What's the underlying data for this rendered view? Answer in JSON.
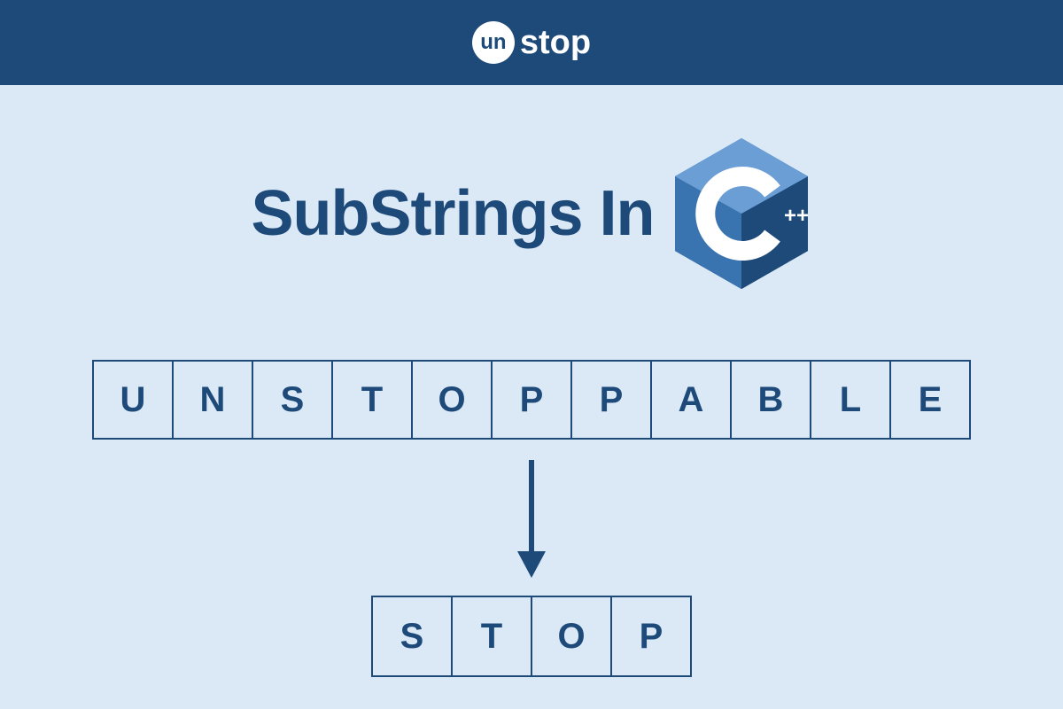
{
  "header": {
    "logo_un": "un",
    "logo_stop": "stop"
  },
  "title": "SubStrings In",
  "cpp_logo": {
    "letter": "C",
    "plusplus": "++"
  },
  "main_word": [
    "U",
    "N",
    "S",
    "T",
    "O",
    "P",
    "P",
    "A",
    "B",
    "L",
    "E"
  ],
  "sub_word": [
    "S",
    "T",
    "O",
    "P"
  ],
  "colors": {
    "header_bg": "#1e4a7a",
    "content_bg": "#dbe9f7",
    "accent": "#1e4a7a",
    "hex_light": "#6a9ed4",
    "hex_mid": "#3a74b0",
    "hex_dark": "#1e4a7a"
  }
}
